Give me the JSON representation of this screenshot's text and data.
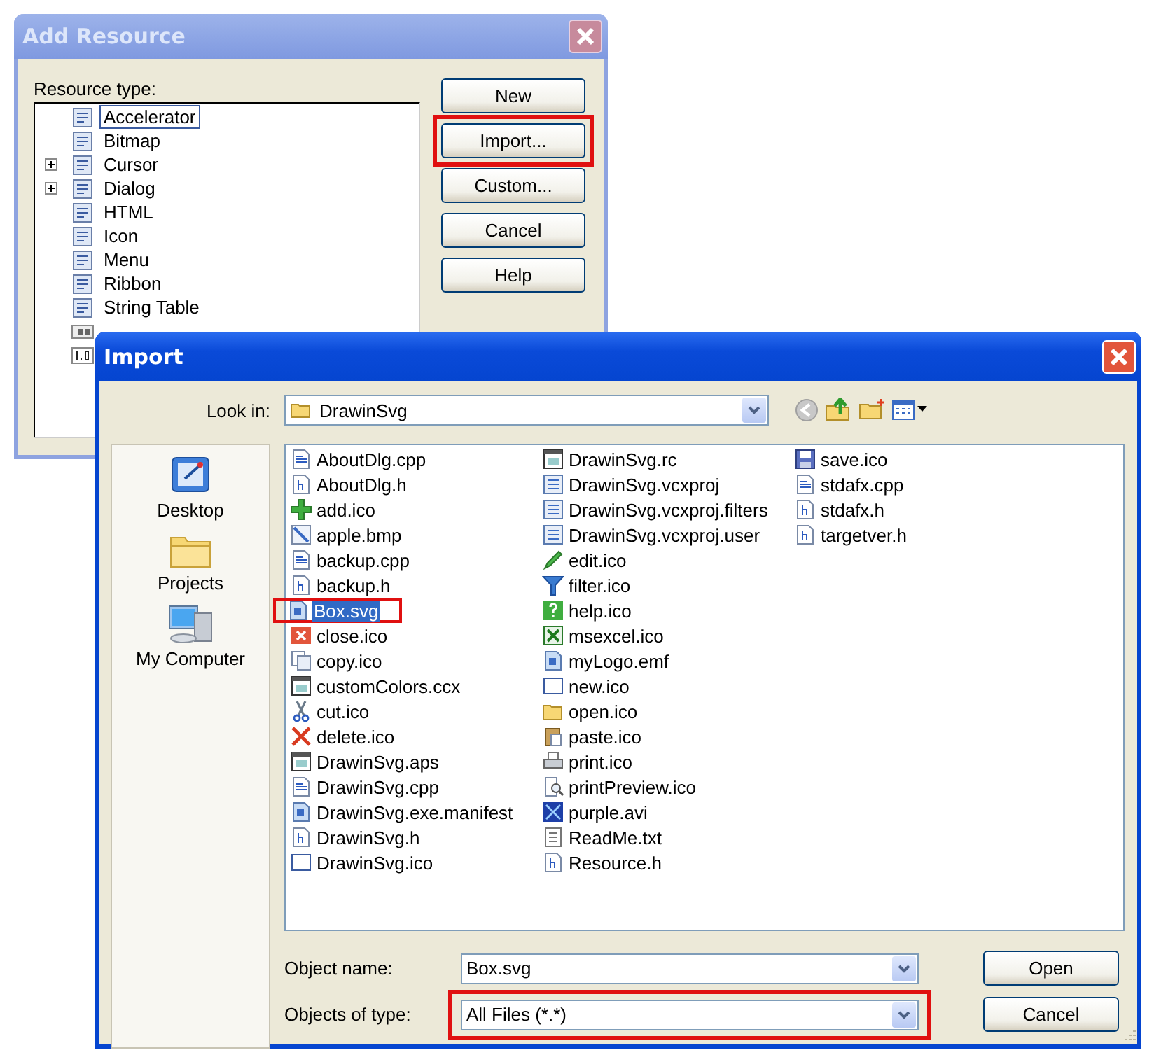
{
  "add_resource": {
    "title": "Add Resource",
    "label": "Resource type:",
    "tree": [
      {
        "label": "Accelerator",
        "selected": true,
        "collapsed": false
      },
      {
        "label": "Bitmap",
        "selected": false,
        "collapsed": false
      },
      {
        "label": "Cursor",
        "selected": false,
        "collapsed": true
      },
      {
        "label": "Dialog",
        "selected": false,
        "collapsed": true
      },
      {
        "label": "HTML",
        "selected": false,
        "collapsed": false
      },
      {
        "label": "Icon",
        "selected": false,
        "collapsed": false
      },
      {
        "label": "Menu",
        "selected": false,
        "collapsed": false
      },
      {
        "label": "Ribbon",
        "selected": false,
        "collapsed": false
      },
      {
        "label": "String Table",
        "selected": false,
        "collapsed": false
      }
    ],
    "buttons": [
      {
        "label": "New",
        "highlighted": false
      },
      {
        "label": "Import...",
        "highlighted": true
      },
      {
        "label": "Custom...",
        "highlighted": false
      },
      {
        "label": "Cancel",
        "highlighted": false
      },
      {
        "label": "Help",
        "highlighted": false
      }
    ]
  },
  "import": {
    "title": "Import",
    "look_in_label": "Look in:",
    "look_in_value": "DrawinSvg",
    "places": [
      "Desktop",
      "Projects",
      "My Computer"
    ],
    "files": [
      {
        "name": "AboutDlg.cpp",
        "kind": "source",
        "selected": false,
        "highlighted": false
      },
      {
        "name": "AboutDlg.h",
        "kind": "header",
        "selected": false,
        "highlighted": false
      },
      {
        "name": "add.ico",
        "kind": "plus",
        "selected": false,
        "highlighted": false
      },
      {
        "name": "apple.bmp",
        "kind": "image",
        "selected": false,
        "highlighted": false
      },
      {
        "name": "backup.cpp",
        "kind": "source",
        "selected": false,
        "highlighted": false
      },
      {
        "name": "backup.h",
        "kind": "header",
        "selected": false,
        "highlighted": false
      },
      {
        "name": "Box.svg",
        "kind": "doc",
        "selected": true,
        "highlighted": true
      },
      {
        "name": "close.ico",
        "kind": "close",
        "selected": false,
        "highlighted": false
      },
      {
        "name": "copy.ico",
        "kind": "copy",
        "selected": false,
        "highlighted": false
      },
      {
        "name": "customColors.ccx",
        "kind": "window",
        "selected": false,
        "highlighted": false
      },
      {
        "name": "cut.ico",
        "kind": "scissors",
        "selected": false,
        "highlighted": false
      },
      {
        "name": "delete.ico",
        "kind": "cross",
        "selected": false,
        "highlighted": false
      },
      {
        "name": "DrawinSvg.aps",
        "kind": "window",
        "selected": false,
        "highlighted": false
      },
      {
        "name": "DrawinSvg.cpp",
        "kind": "source",
        "selected": false,
        "highlighted": false
      },
      {
        "name": "DrawinSvg.exe.manifest",
        "kind": "doc",
        "selected": false,
        "highlighted": false
      },
      {
        "name": "DrawinSvg.h",
        "kind": "header",
        "selected": false,
        "highlighted": false
      },
      {
        "name": "DrawinSvg.ico",
        "kind": "blank",
        "selected": false,
        "highlighted": false
      },
      {
        "name": "DrawinSvg.rc",
        "kind": "window",
        "selected": false,
        "highlighted": false
      },
      {
        "name": "DrawinSvg.vcxproj",
        "kind": "project",
        "selected": false,
        "highlighted": false
      },
      {
        "name": "DrawinSvg.vcxproj.filters",
        "kind": "project",
        "selected": false,
        "highlighted": false
      },
      {
        "name": "DrawinSvg.vcxproj.user",
        "kind": "project",
        "selected": false,
        "highlighted": false
      },
      {
        "name": "edit.ico",
        "kind": "pencil",
        "selected": false,
        "highlighted": false
      },
      {
        "name": "filter.ico",
        "kind": "funnel",
        "selected": false,
        "highlighted": false
      },
      {
        "name": "help.ico",
        "kind": "help",
        "selected": false,
        "highlighted": false
      },
      {
        "name": "msexcel.ico",
        "kind": "sheet",
        "selected": false,
        "highlighted": false
      },
      {
        "name": "myLogo.emf",
        "kind": "doc",
        "selected": false,
        "highlighted": false
      },
      {
        "name": "new.ico",
        "kind": "blank",
        "selected": false,
        "highlighted": false
      },
      {
        "name": "open.ico",
        "kind": "folder",
        "selected": false,
        "highlighted": false
      },
      {
        "name": "paste.ico",
        "kind": "clipboard",
        "selected": false,
        "highlighted": false
      },
      {
        "name": "print.ico",
        "kind": "printer",
        "selected": false,
        "highlighted": false
      },
      {
        "name": "printPreview.ico",
        "kind": "magnifier",
        "selected": false,
        "highlighted": false
      },
      {
        "name": "purple.avi",
        "kind": "video",
        "selected": false,
        "highlighted": false
      },
      {
        "name": "ReadMe.txt",
        "kind": "text",
        "selected": false,
        "highlighted": false
      },
      {
        "name": "Resource.h",
        "kind": "header",
        "selected": false,
        "highlighted": false
      },
      {
        "name": "save.ico",
        "kind": "disk",
        "selected": false,
        "highlighted": false
      },
      {
        "name": "stdafx.cpp",
        "kind": "source",
        "selected": false,
        "highlighted": false
      },
      {
        "name": "stdafx.h",
        "kind": "header",
        "selected": false,
        "highlighted": false
      },
      {
        "name": "targetver.h",
        "kind": "header",
        "selected": false,
        "highlighted": false
      }
    ],
    "name_label": "Object name:",
    "name_value": "Box.svg",
    "type_label": "Objects of type:",
    "type_value": "All Files (*.*)",
    "type_highlighted": true,
    "buttons": [
      "Open",
      "Cancel"
    ]
  }
}
